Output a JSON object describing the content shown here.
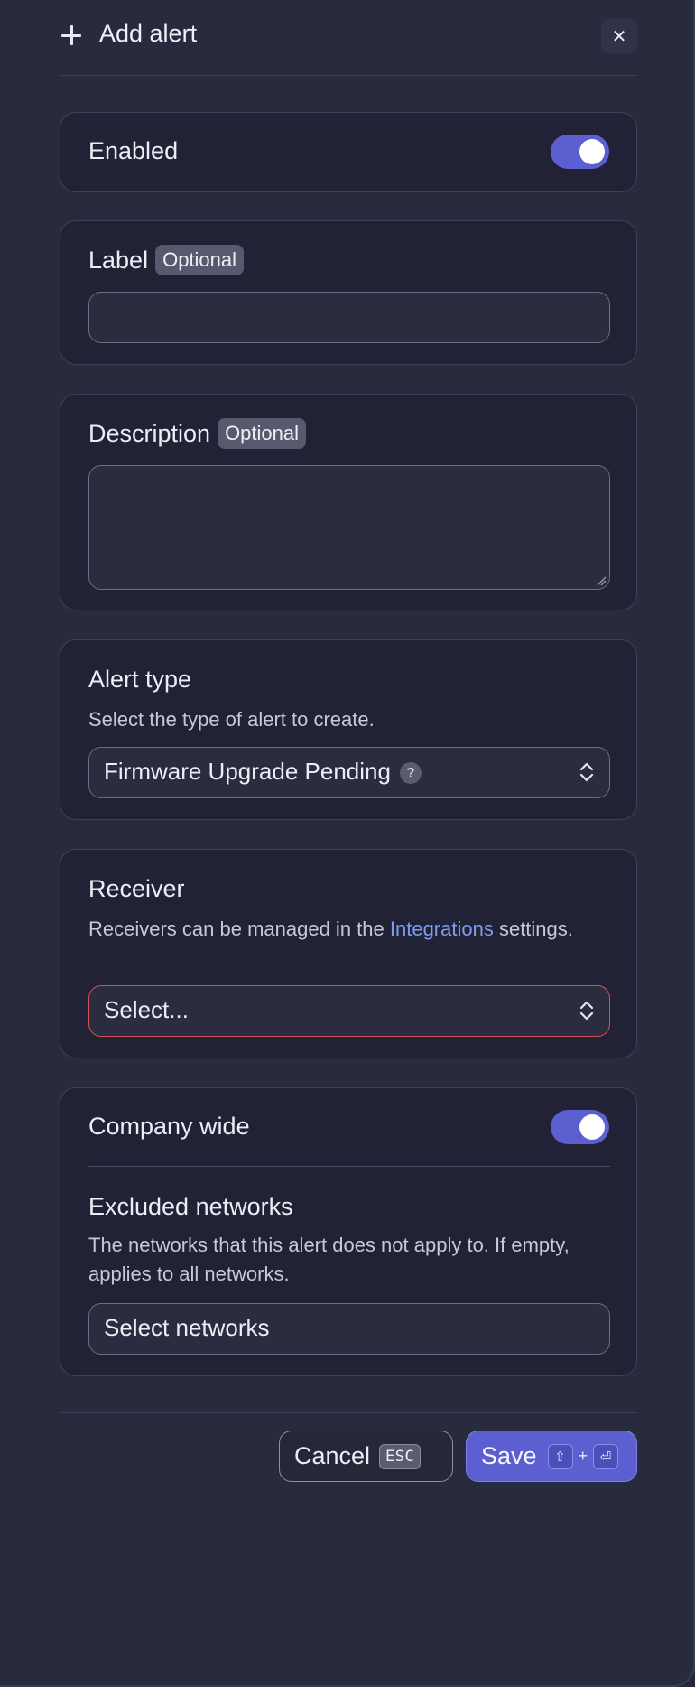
{
  "header": {
    "title": "Add alert",
    "close_glyph": "✕"
  },
  "enabled": {
    "label": "Enabled",
    "on": true
  },
  "label_field": {
    "label": "Label",
    "badge": "Optional",
    "value": ""
  },
  "description_field": {
    "label": "Description",
    "badge": "Optional",
    "value": ""
  },
  "alert_type": {
    "label": "Alert type",
    "help": "Select the type of alert to create.",
    "selected": "Firmware Upgrade Pending",
    "help_glyph": "?"
  },
  "receiver": {
    "label": "Receiver",
    "help_prefix": "Receivers can be managed in the ",
    "help_link": "Integrations",
    "help_suffix": " settings.",
    "placeholder": "Select..."
  },
  "company_wide": {
    "label": "Company wide",
    "on": true
  },
  "excluded_networks": {
    "label": "Excluded networks",
    "help": "The networks that this alert does not apply to. If empty, applies to all networks.",
    "placeholder": "Select networks"
  },
  "footer": {
    "cancel_label": "Cancel",
    "cancel_key": "ESC",
    "save_label": "Save",
    "save_key_shift": "⇧",
    "save_key_plus": "+",
    "save_key_enter": "⏎"
  },
  "colors": {
    "accent": "#5b5fcf",
    "error_border": "#d5534f",
    "link": "#7e9cf0"
  }
}
